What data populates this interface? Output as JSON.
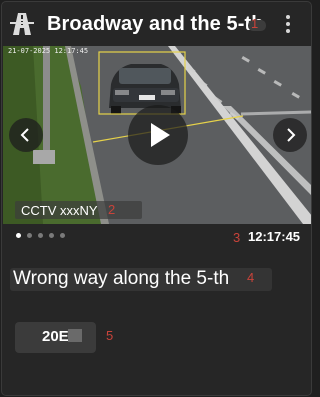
{
  "header": {
    "title": "Broadway and the 5-th",
    "icon": "highway-icon",
    "annotation_number": "1",
    "menu_icon": "more-vertical-icon"
  },
  "camera": {
    "overlay_timestamp": "21-07-2025 12:17:45",
    "label": "CCTV xxxNY",
    "annotation_number": "2",
    "prev_icon": "chevron-left-icon",
    "next_icon": "chevron-right-icon",
    "play_icon": "play-icon"
  },
  "carousel": {
    "slide_count": 5,
    "active_index": 0
  },
  "event": {
    "time_annotation_number": "3",
    "time": "12:17:45",
    "title": "Wrong way along the 5-th",
    "title_annotation_number": "4"
  },
  "plate": {
    "text": "20E",
    "annotation_number": "5"
  },
  "colors": {
    "background": "#262626",
    "annotation": "#c8433a",
    "detection_box": "#e6d24a"
  }
}
